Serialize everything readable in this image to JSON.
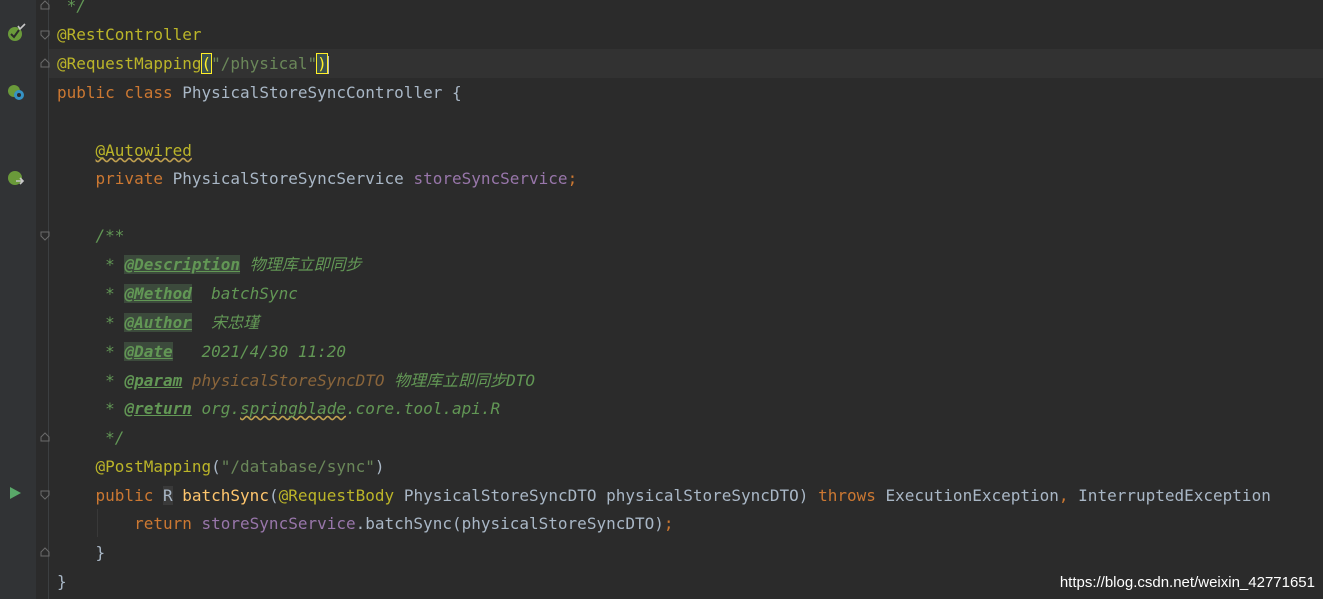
{
  "code": {
    "line0": " */",
    "rest_controller": "@RestController",
    "request_mapping": "@RequestMapping",
    "rm_open": "(",
    "rm_value": "\"/physical\"",
    "rm_close": ")",
    "kw_public": "public",
    "kw_class": "class",
    "class_name": "PhysicalStoreSyncController",
    "brace_open": "{",
    "autowired": "@Autowired",
    "kw_private": "private",
    "service_type": "PhysicalStoreSyncService",
    "service_field": "storeSyncService",
    "semicolon": ";",
    "doc_open": "/**",
    "doc_star": " * ",
    "tag_description": "@Description",
    "val_description": " 物理库立即同步",
    "tag_method": "@Method",
    "val_method": "  batchSync",
    "tag_author": "@Author",
    "val_author": "  宋忠瑾",
    "tag_date": "@Date",
    "val_date": "   2021/4/30 11:20",
    "tag_param": "@param",
    "param_name": " physicalStoreSyncDTO",
    "param_desc": " 物理库立即同步DTO",
    "tag_return": "@return",
    "ret_pre": " org.",
    "ret_pkg": "springblade",
    "ret_post": ".core.tool.api.R",
    "doc_close": " */",
    "post_mapping": "@PostMapping",
    "pm_open": "(",
    "pm_value": "\"/database/sync\"",
    "pm_close": ")",
    "ret_type": "R",
    "method_name": "batchSync",
    "m_open": "(",
    "request_body": "@RequestBody",
    "dto_type": "PhysicalStoreSyncDTO",
    "dto_param": "physicalStoreSyncDTO",
    "m_close": ")",
    "kw_throws": "throws",
    "exc1": "ExecutionException",
    "comma": ",",
    "exc2": "InterruptedException",
    "kw_return": "return",
    "call_field": "storeSyncService",
    "call_rest": ".batchSync(physicalStoreSyncDTO)",
    "brace_close": "}"
  },
  "watermark": "https://blog.csdn.net/weixin_42771651",
  "colors": {
    "background": "#2b2b2b",
    "annotation": "#bbb529",
    "keyword": "#cc7832",
    "string": "#6a8759",
    "field": "#9876aa",
    "method": "#ffc66d",
    "doc_comment": "#629755"
  },
  "icons": {
    "line1": "spring-bean-check-icon",
    "line3": "spring-controller-icon",
    "line6": "spring-autowired-icon",
    "line17": "run-gutter-icon"
  }
}
